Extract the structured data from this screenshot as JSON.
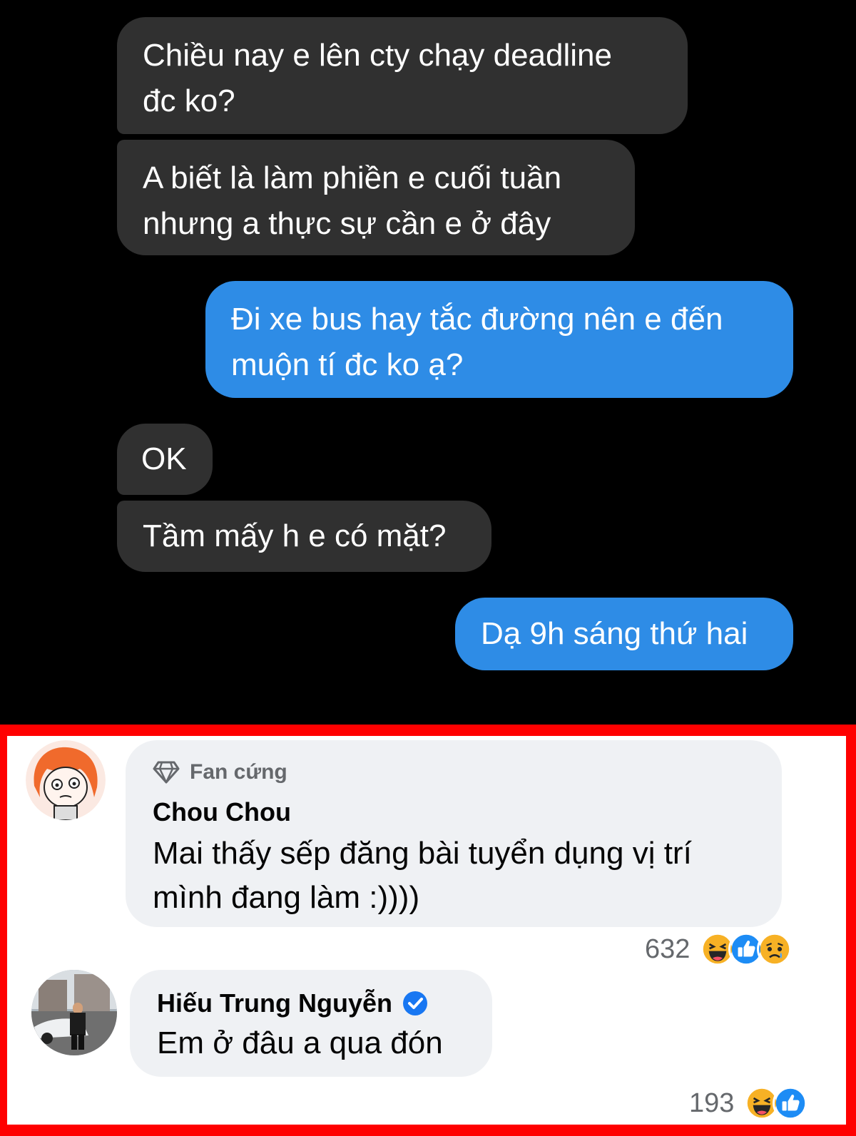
{
  "chat": {
    "messages": [
      {
        "side": "in",
        "text_lines": [
          "Chiều nay e lên cty chạy deadline",
          "đc ko?"
        ]
      },
      {
        "side": "in",
        "text_lines": [
          "A biết là làm phiền e cuối tuần",
          "nhưng a thực sự cần e ở đây"
        ]
      },
      {
        "side": "out",
        "text_lines": [
          "Đi xe bus hay tắc đường nên e đến",
          "muộn tí đc ko ạ?"
        ]
      },
      {
        "side": "in",
        "text_lines": [
          "OK"
        ]
      },
      {
        "side": "in",
        "text_lines": [
          "Tầm mấy h e có mặt?"
        ]
      },
      {
        "side": "out",
        "text_lines": [
          "Dạ 9h sáng thứ hai"
        ]
      }
    ]
  },
  "comments": [
    {
      "badge": "Fan cứng",
      "name": "Chou Chou",
      "text_lines": [
        "Mai thấy sếp đăng bài tuyển dụng vị trí",
        "mình đang làm :))))"
      ],
      "reaction_count": "632",
      "reactions": [
        "haha-icon",
        "like-icon",
        "sad-icon"
      ]
    },
    {
      "name": "Hiếu Trung Nguyễn",
      "verified": true,
      "text_lines": [
        "Em ở đâu a qua đón"
      ],
      "reaction_count": "193",
      "reactions": [
        "haha-icon",
        "like-icon"
      ]
    }
  ],
  "colors": {
    "incoming_bubble": "#303030",
    "outgoing_bubble": "#2e8ce6",
    "highlight_border": "#ff0000",
    "comment_bubble": "#eff1f4",
    "verified": "#1877f2"
  }
}
